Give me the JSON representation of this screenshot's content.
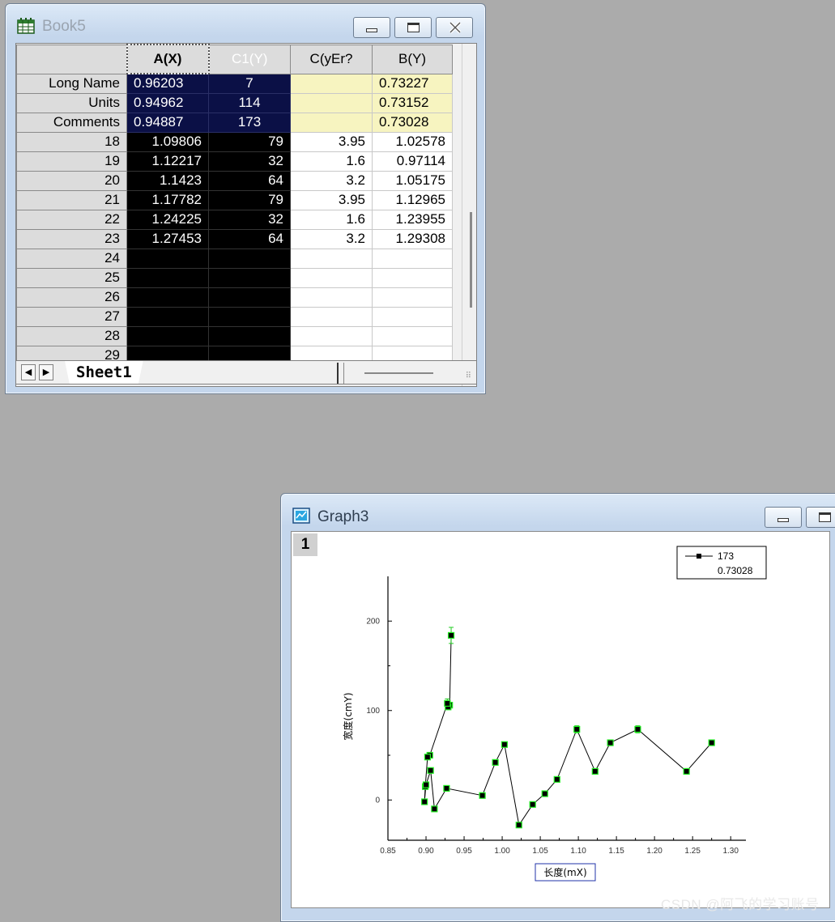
{
  "book": {
    "title": "Book5",
    "columns": [
      "A(X)",
      "C1(Y)",
      "C(yEr?",
      "B(Y)"
    ],
    "meta_rows": [
      {
        "label": "Long Name",
        "cells": [
          "0.96203",
          "7",
          "",
          "0.73227"
        ]
      },
      {
        "label": "Units",
        "cells": [
          "0.94962",
          "114",
          "",
          "0.73152"
        ]
      },
      {
        "label": "Comments",
        "cells": [
          "0.94887",
          "173",
          "",
          "0.73028"
        ]
      }
    ],
    "rows": [
      {
        "label": "18",
        "cells": [
          "1.09806",
          "79",
          "3.95",
          "1.02578"
        ]
      },
      {
        "label": "19",
        "cells": [
          "1.12217",
          "32",
          "1.6",
          "0.97114"
        ]
      },
      {
        "label": "20",
        "cells": [
          "1.1423",
          "64",
          "3.2",
          "1.05175"
        ]
      },
      {
        "label": "21",
        "cells": [
          "1.17782",
          "79",
          "3.95",
          "1.12965"
        ]
      },
      {
        "label": "22",
        "cells": [
          "1.24225",
          "32",
          "1.6",
          "1.23955"
        ]
      },
      {
        "label": "23",
        "cells": [
          "1.27453",
          "64",
          "3.2",
          "1.29308"
        ]
      },
      {
        "label": "24",
        "cells": [
          "",
          "",
          "",
          ""
        ]
      },
      {
        "label": "25",
        "cells": [
          "",
          "",
          "",
          ""
        ]
      },
      {
        "label": "26",
        "cells": [
          "",
          "",
          "",
          ""
        ]
      },
      {
        "label": "27",
        "cells": [
          "",
          "",
          "",
          ""
        ]
      },
      {
        "label": "28",
        "cells": [
          "",
          "",
          "",
          ""
        ]
      },
      {
        "label": "29",
        "cells": [
          "",
          "",
          "",
          ""
        ]
      }
    ],
    "sheet_tab": "Sheet1",
    "nav_prev": "◀",
    "nav_next": "▶"
  },
  "graph": {
    "title": "Graph3",
    "layer": "1"
  },
  "chart_data": {
    "type": "scatter",
    "xlabel": "长度(mX)",
    "ylabel": "宽度(cmY)",
    "xlim": [
      0.85,
      1.32
    ],
    "ylim": [
      -45,
      250
    ],
    "xticks": [
      "0.85",
      "0.90",
      "0.95",
      "1.00",
      "1.05",
      "1.10",
      "1.15",
      "1.20",
      "1.25",
      "1.30"
    ],
    "yticks": [
      "0",
      "100",
      "200"
    ],
    "legend": {
      "position": "top-right",
      "entries": [
        "173",
        "0.73028"
      ]
    },
    "series": [
      {
        "name": "173",
        "x": [
          0.933,
          0.931,
          0.929,
          0.928,
          0.905,
          0.902,
          0.899,
          0.898,
          0.9,
          0.906,
          0.911,
          0.927,
          0.974,
          0.991,
          1.003,
          1.022,
          1.04,
          1.056,
          1.072,
          1.098,
          1.122,
          1.142,
          1.178,
          1.242,
          1.275
        ],
        "y": [
          184,
          106,
          104,
          108,
          50,
          48,
          15,
          -2,
          17,
          33,
          -10,
          13,
          5,
          42,
          62,
          -28,
          -5,
          7,
          23,
          79,
          32,
          64,
          79,
          32,
          64
        ],
        "yerr": [
          9,
          0,
          0,
          5,
          0,
          0,
          0,
          0,
          0,
          0,
          0,
          0,
          0,
          0,
          0,
          0,
          0,
          0,
          0,
          3.95,
          1.6,
          3.2,
          3.95,
          1.6,
          3.2
        ]
      }
    ]
  },
  "watermark": "CSDN @阿飞的学习账号"
}
